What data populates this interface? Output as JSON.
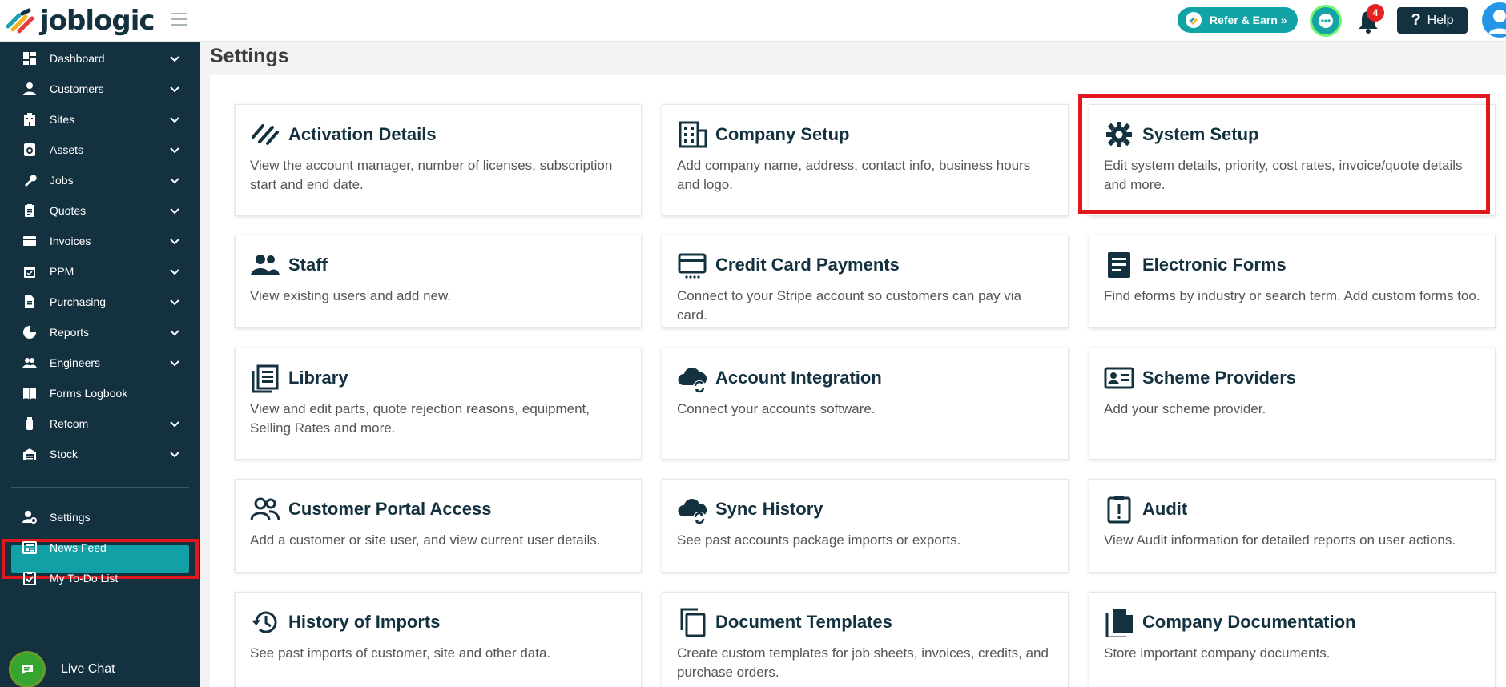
{
  "app": {
    "logo_text": "joblogic"
  },
  "topbar": {
    "refer_label": "Refer & Earn »",
    "notifications_count": "4",
    "help_label": "Help"
  },
  "sidebar": {
    "items": [
      {
        "label": "Dashboard",
        "icon": "dashboard-icon",
        "chevron": true
      },
      {
        "label": "Customers",
        "icon": "person-icon",
        "chevron": true
      },
      {
        "label": "Sites",
        "icon": "building-icon",
        "chevron": true
      },
      {
        "label": "Assets",
        "icon": "asset-icon",
        "chevron": true
      },
      {
        "label": "Jobs",
        "icon": "wrench-icon",
        "chevron": true
      },
      {
        "label": "Quotes",
        "icon": "clipboard-icon",
        "chevron": true
      },
      {
        "label": "Invoices",
        "icon": "card-icon",
        "chevron": true
      },
      {
        "label": "PPM",
        "icon": "calendar-icon",
        "chevron": true
      },
      {
        "label": "Purchasing",
        "icon": "document-icon",
        "chevron": true
      },
      {
        "label": "Reports",
        "icon": "pie-icon",
        "chevron": true
      },
      {
        "label": "Engineers",
        "icon": "people-icon",
        "chevron": true
      },
      {
        "label": "Forms Logbook",
        "icon": "book-icon",
        "chevron": false
      },
      {
        "label": "Refcom",
        "icon": "canister-icon",
        "chevron": true
      },
      {
        "label": "Stock",
        "icon": "warehouse-icon",
        "chevron": true
      }
    ],
    "bottom_items": [
      {
        "label": "Settings",
        "icon": "user-gear-icon",
        "active": true
      },
      {
        "label": "News Feed",
        "icon": "newspaper-icon",
        "active": false
      },
      {
        "label": "My To-Do List",
        "icon": "checklist-icon",
        "active": false
      }
    ],
    "live_chat_label": "Live Chat"
  },
  "main": {
    "title": "Settings",
    "cards": [
      {
        "title": "Activation Details",
        "desc": "View the account manager, number of licenses, subscription start and end date.",
        "icon": "joblogic-mark-icon"
      },
      {
        "title": "Company Setup",
        "desc": "Add company name, address, contact info, business hours and logo.",
        "icon": "office-building-icon"
      },
      {
        "title": "System Setup",
        "desc": "Edit system details, priority, cost rates, invoice/quote details and more.",
        "icon": "gear-icon"
      },
      {
        "title": "Staff",
        "desc": "View existing users and add new.",
        "icon": "staff-icon"
      },
      {
        "title": "Credit Card Payments",
        "desc": "Connect to your Stripe account so customers can pay via card.",
        "icon": "credit-card-icon"
      },
      {
        "title": "Electronic Forms",
        "desc": "Find eforms by industry or search term. Add custom forms too.",
        "icon": "form-icon"
      },
      {
        "title": "Library",
        "desc": "View and edit parts, quote rejection reasons, equipment, Selling Rates and more.",
        "icon": "library-icon"
      },
      {
        "title": "Account Integration",
        "desc": "Connect your accounts software.",
        "icon": "cloud-sync-icon"
      },
      {
        "title": "Scheme Providers",
        "desc": "Add your scheme provider.",
        "icon": "id-card-icon"
      },
      {
        "title": "Customer Portal Access",
        "desc": "Add a customer or site user, and view current user details.",
        "icon": "users-outline-icon"
      },
      {
        "title": "Sync History",
        "desc": "See past accounts package imports or exports.",
        "icon": "cloud-sync-icon"
      },
      {
        "title": "Audit",
        "desc": "View Audit information for detailed reports on user actions.",
        "icon": "audit-clipboard-icon"
      },
      {
        "title": "History of Imports",
        "desc": "See past imports of customer, site and other data.",
        "icon": "history-icon"
      },
      {
        "title": "Document Templates",
        "desc": "Create custom templates for job sheets, invoices, credits, and purchase orders.",
        "icon": "copy-icon"
      },
      {
        "title": "Company Documentation",
        "desc": "Store important company documents.",
        "icon": "file-stack-icon"
      }
    ]
  }
}
